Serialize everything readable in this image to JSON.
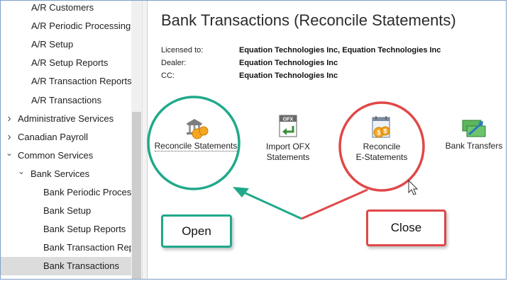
{
  "sidebar": {
    "items": [
      {
        "label": "A/R Customers",
        "indent": 2,
        "expander": ""
      },
      {
        "label": "A/R Periodic Processing",
        "indent": 2,
        "expander": ""
      },
      {
        "label": "A/R Setup",
        "indent": 2,
        "expander": ""
      },
      {
        "label": "A/R Setup Reports",
        "indent": 2,
        "expander": ""
      },
      {
        "label": "A/R Transaction Reports",
        "indent": 2,
        "expander": ""
      },
      {
        "label": "A/R Transactions",
        "indent": 2,
        "expander": ""
      },
      {
        "label": "Administrative Services",
        "indent": 1,
        "expander": "collapsed"
      },
      {
        "label": "Canadian Payroll",
        "indent": 1,
        "expander": "collapsed"
      },
      {
        "label": "Common Services",
        "indent": 1,
        "expander": "expanded"
      },
      {
        "label": "Bank Services",
        "indent": 2,
        "expander": "expanded"
      },
      {
        "label": "Bank Periodic Processing",
        "indent": 3,
        "expander": ""
      },
      {
        "label": "Bank Setup",
        "indent": 3,
        "expander": ""
      },
      {
        "label": "Bank Setup Reports",
        "indent": 3,
        "expander": ""
      },
      {
        "label": "Bank Transaction Reports",
        "indent": 3,
        "expander": ""
      },
      {
        "label": "Bank Transactions",
        "indent": 3,
        "expander": "",
        "selected": true
      }
    ]
  },
  "main": {
    "title": "Bank Transactions (Reconcile Statements)",
    "license": {
      "licensed_to_label": "Licensed to:",
      "licensed_to_value": "Equation Technologies Inc, Equation Technologies Inc",
      "dealer_label": "Dealer:",
      "dealer_value": "Equation Technologies Inc",
      "cc_label": "CC:",
      "cc_value": "Equation Technologies Inc"
    },
    "tiles": {
      "reconcile_statements": "Reconcile Statements",
      "import_ofx_line1": "Import OFX",
      "import_ofx_line2": "Statements",
      "ofx_badge": "OFX",
      "reconcile_e_line1": "Reconcile",
      "reconcile_e_line2": "E-Statements",
      "bank_transfers": "Bank Transfers"
    },
    "coin_symbol": "$"
  },
  "annotations": {
    "open_label": "Open",
    "close_label": "Close"
  },
  "colors": {
    "open_green": "#1fa98a",
    "close_red": "#e04848",
    "selected_row": "#dcdcdc",
    "coin_orange": "#f5a623"
  }
}
